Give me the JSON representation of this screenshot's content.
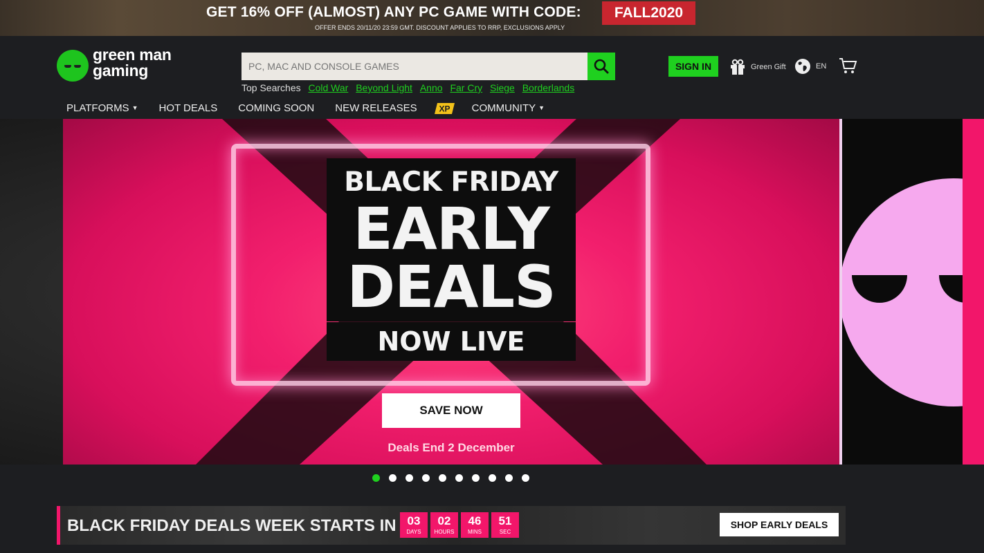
{
  "promo": {
    "headline": "GET 16% OFF (ALMOST) ANY PC GAME WITH CODE:",
    "code": "FALL2020",
    "subtext": "OFFER ENDS 20/11/20 23:59 GMT. DISCOUNT APPLIES TO RRP, EXCLUSIONS APPLY"
  },
  "header": {
    "logo_line1": "green man",
    "logo_line2": "gaming",
    "search_placeholder": "PC, MAC AND CONSOLE GAMES",
    "search_icon": "search-icon",
    "top_searches_label": "Top Searches",
    "top_searches": [
      "Cold War",
      "Beyond Light",
      "Anno",
      "Far Cry",
      "Siege",
      "Borderlands"
    ],
    "sign_in": "SIGN IN",
    "green_gift": "Green Gift",
    "language": "EN",
    "cart_icon": "cart-icon"
  },
  "nav": {
    "platforms": "PLATFORMS",
    "hot_deals": "HOT DEALS",
    "coming_soon": "COMING SOON",
    "new_releases": "NEW RELEASES",
    "xp": "XP",
    "community": "COMMUNITY"
  },
  "hero": {
    "line1": "BLACK FRIDAY",
    "line2": "EARLY",
    "line3": "DEALS",
    "line4": "NOW LIVE",
    "cta": "SAVE NOW",
    "deals_end": "Deals End 2 December",
    "slide_count": 10,
    "active_slide": 1
  },
  "countdown": {
    "title": "BLACK FRIDAY DEALS WEEK STARTS IN",
    "days": "03",
    "days_label": "DAYS",
    "hours": "02",
    "hours_label": "HOURS",
    "mins": "46",
    "mins_label": "MINS",
    "sec": "51",
    "sec_label": "SEC",
    "cta": "SHOP EARLY DEALS"
  },
  "colors": {
    "brand_green": "#1fd01f",
    "brand_pink": "#f2166a",
    "promo_red": "#c8262f",
    "header_bg": "#1d1e21"
  }
}
